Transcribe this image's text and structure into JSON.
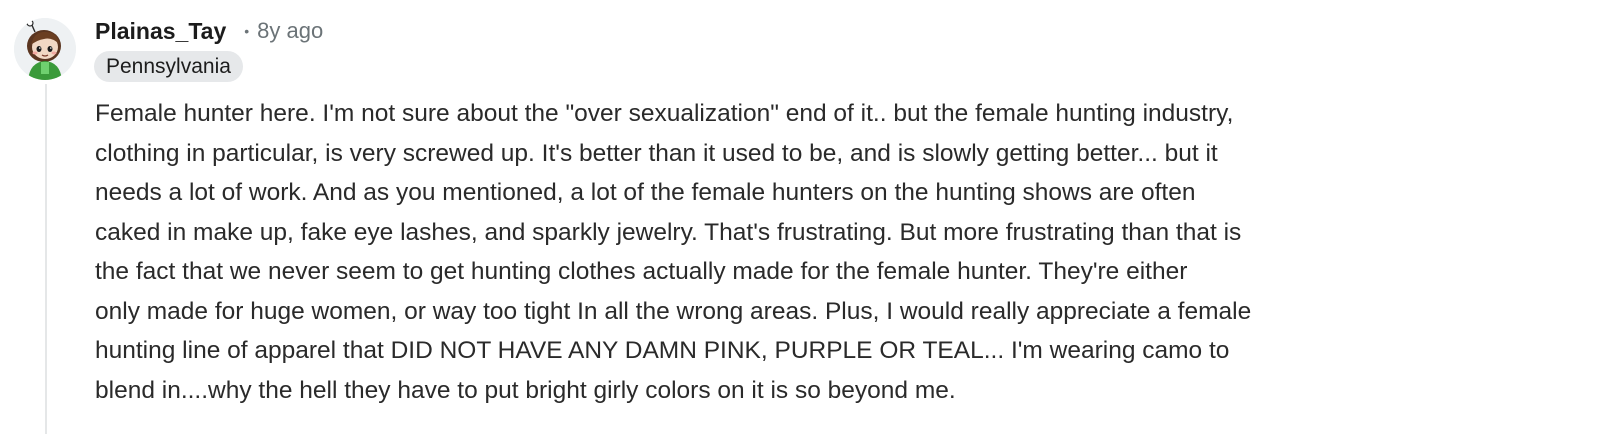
{
  "comment": {
    "avatar_icon": "snoo-avatar-icon",
    "username": "Plainas_Tay",
    "separator": "•",
    "timestamp": "8y ago",
    "flair": "Pennsylvania",
    "body_lines": [
      "Female hunter here. I'm not sure about the \"over sexualization\" end of it.. but the female hunting industry,",
      "clothing in particular, is very screwed up. It's better than it used to be, and is slowly getting better... but it",
      "needs a lot of work. And as you mentioned, a lot of the female hunters on the hunting shows are often",
      "caked in make up, fake eye lashes, and sparkly jewelry. That's frustrating. But more frustrating than that is",
      "the fact that we never seem to get hunting clothes actually made for the female hunter. They're either",
      "only made for huge women, or way too tight In all the wrong areas. Plus, I would really appreciate a female",
      "hunting line of apparel that DID NOT HAVE ANY DAMN PINK, PURPLE OR TEAL... I'm wearing camo to",
      "blend in....why the hell they have to put bright girly colors on it is so beyond me."
    ]
  },
  "colors": {
    "text": "#1c1c1c",
    "muted": "#6b7377",
    "flair_bg": "#e6e8ea",
    "thread_line": "#e5e7e8"
  }
}
